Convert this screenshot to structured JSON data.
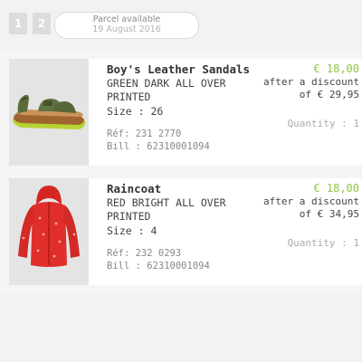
{
  "steps": [
    "1",
    "2"
  ],
  "parcel": {
    "status": "Parcel available",
    "date": "19 August 2016"
  },
  "items": [
    {
      "name": "Boy's Leather Sandals",
      "desc_line1": "GREEN DARK ALL OVER",
      "desc_line2": "PRINTED",
      "size": "Size : 26",
      "ref": "Réf: 231 2770",
      "bill": "Bill : 62310001094",
      "price": "€ 18,00",
      "discount_line1": "after a discount",
      "discount_line2": "of € 29,95",
      "quantity": "Quantity : 1",
      "image_icon": "sandal-icon"
    },
    {
      "name": "Raincoat",
      "desc_line1": "RED BRIGHT ALL OVER",
      "desc_line2": "PRINTED",
      "size": "Size : 4",
      "ref": "Réf: 232 0293",
      "bill": "Bill : 62310001094",
      "price": "€ 18,00",
      "discount_line1": "after a discount",
      "discount_line2": "of € 34,95",
      "quantity": "Quantity : 1",
      "image_icon": "raincoat-icon"
    }
  ],
  "colors": {
    "price": "#8dc63f",
    "step_bg": "#dcdcdc",
    "thumb_bg": "#e4e4e4"
  }
}
